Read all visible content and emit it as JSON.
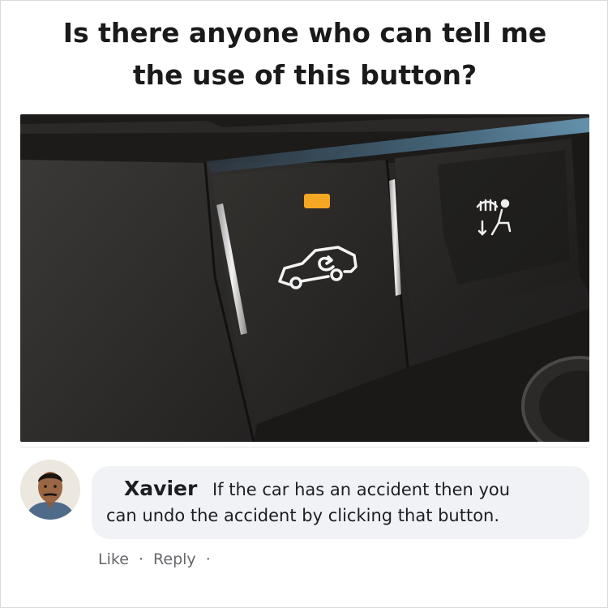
{
  "post": {
    "headline_line1": "Is there anyone who can tell me",
    "headline_line2": "the use of this button?"
  },
  "photo": {
    "subject": "car-dashboard-button-icon",
    "indicator_color": "#f5a623"
  },
  "comment": {
    "author": "Xavier",
    "text_line1": "If the car has an accident then you",
    "text_line2": "can undo the accident by clicking that button.",
    "actions": {
      "like": "Like",
      "separator": "·",
      "reply": "Reply",
      "trailing_separator": "·"
    }
  },
  "colors": {
    "bubble_bg": "#f0f2f5",
    "action_text": "#65676b",
    "headline_text": "#1a1a1a"
  }
}
